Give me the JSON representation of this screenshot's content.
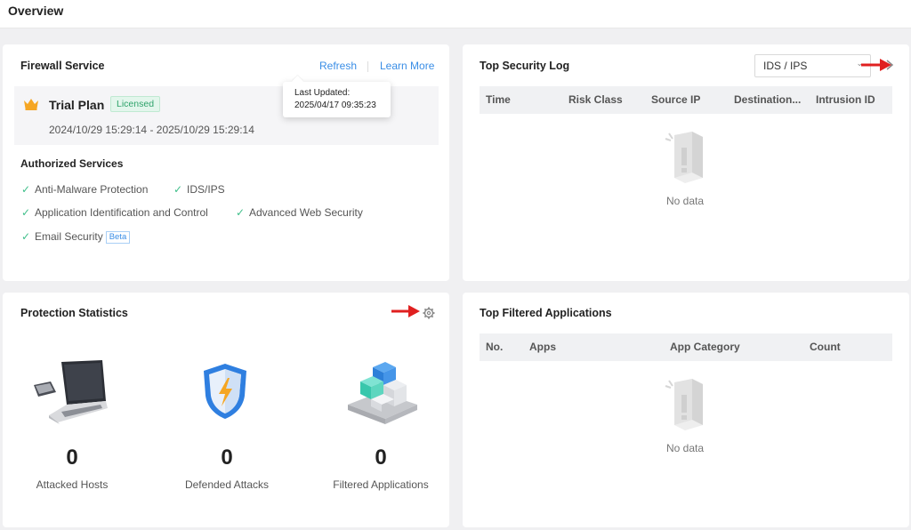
{
  "header": {
    "title": "Overview"
  },
  "firewall": {
    "title": "Firewall Service",
    "refresh_label": "Refresh",
    "learn_more_label": "Learn More",
    "plan_name": "Trial Plan",
    "plan_badge": "Licensed",
    "plan_dates": "2024/10/29 15:29:14 - 2025/10/29 15:29:14",
    "tooltip": {
      "label": "Last Updated:",
      "value": "2025/04/17 09:35:23"
    },
    "services_title": "Authorized Services",
    "services": [
      {
        "label": "Anti-Malware Protection"
      },
      {
        "label": "IDS/IPS"
      },
      {
        "label": "Application Identification and Control"
      },
      {
        "label": "Advanced Web Security"
      },
      {
        "label": "Email Security",
        "badge": "Beta"
      }
    ]
  },
  "security_log": {
    "title": "Top Security Log",
    "filter_value": "IDS / IPS",
    "columns": [
      "Time",
      "Risk Class",
      "Source IP",
      "Destination...",
      "Intrusion ID"
    ],
    "empty_text": "No data"
  },
  "protection": {
    "title": "Protection Statistics",
    "stats": [
      {
        "value": "0",
        "label": "Attacked Hosts"
      },
      {
        "value": "0",
        "label": "Defended Attacks"
      },
      {
        "value": "0",
        "label": "Filtered Applications"
      }
    ]
  },
  "apps": {
    "title": "Top Filtered Applications",
    "columns": [
      "No.",
      "Apps",
      "App Category",
      "Count"
    ],
    "empty_text": "No data"
  },
  "colors": {
    "accent": "#3a8ee6",
    "check": "#3fbf8a",
    "arrow": "#e02020"
  }
}
